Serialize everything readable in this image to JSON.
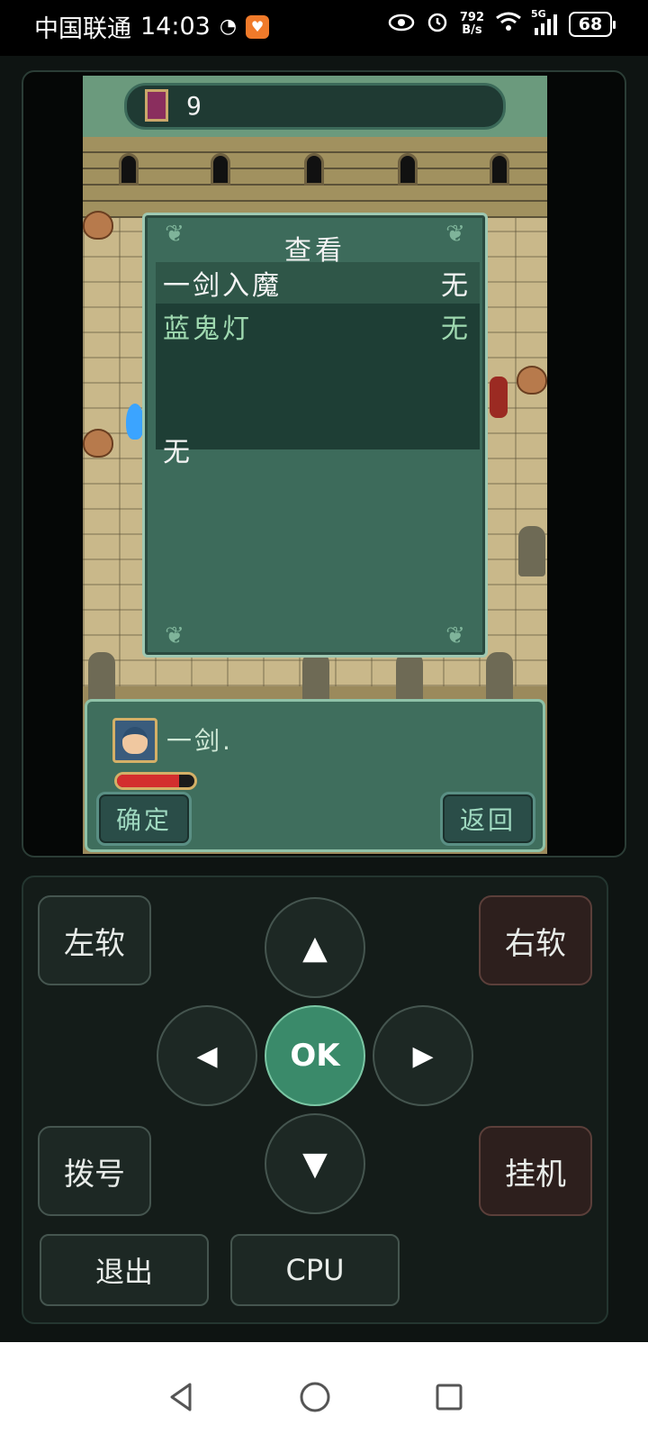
{
  "status_bar": {
    "carrier": "中国联通",
    "time": "14:03",
    "net_speed_value": "792",
    "net_speed_unit": "B/s",
    "signal_type": "5G",
    "battery": "68"
  },
  "game": {
    "floor_number": "9",
    "dialog": {
      "title": "查看",
      "items": [
        {
          "name": "一剑入魔",
          "value": "无"
        },
        {
          "name": "蓝鬼灯",
          "value": "无"
        }
      ],
      "description": "无"
    },
    "info_panel": {
      "character_name": "一剑.",
      "hp_fraction": 0.8,
      "confirm_label": "确定",
      "back_label": "返回"
    }
  },
  "controls": {
    "left_soft": "左软",
    "right_soft": "右软",
    "dial": "拨号",
    "hangup": "挂机",
    "ok": "OK",
    "up": "▲",
    "down": "▼",
    "left": "◀",
    "right": "▶",
    "exit": "退出",
    "cpu": "CPU"
  },
  "colors": {
    "ok_button": "#3a8a6a",
    "dialog_bg": "#3d6b5b",
    "selected_row": "#2f5648"
  },
  "icons": [
    "clock-icon",
    "app-icon",
    "eye-icon",
    "alarm-icon",
    "wifi-icon",
    "signal-icon",
    "battery-icon",
    "hourglass-icon",
    "back-nav-icon",
    "home-nav-icon",
    "recents-nav-icon"
  ]
}
